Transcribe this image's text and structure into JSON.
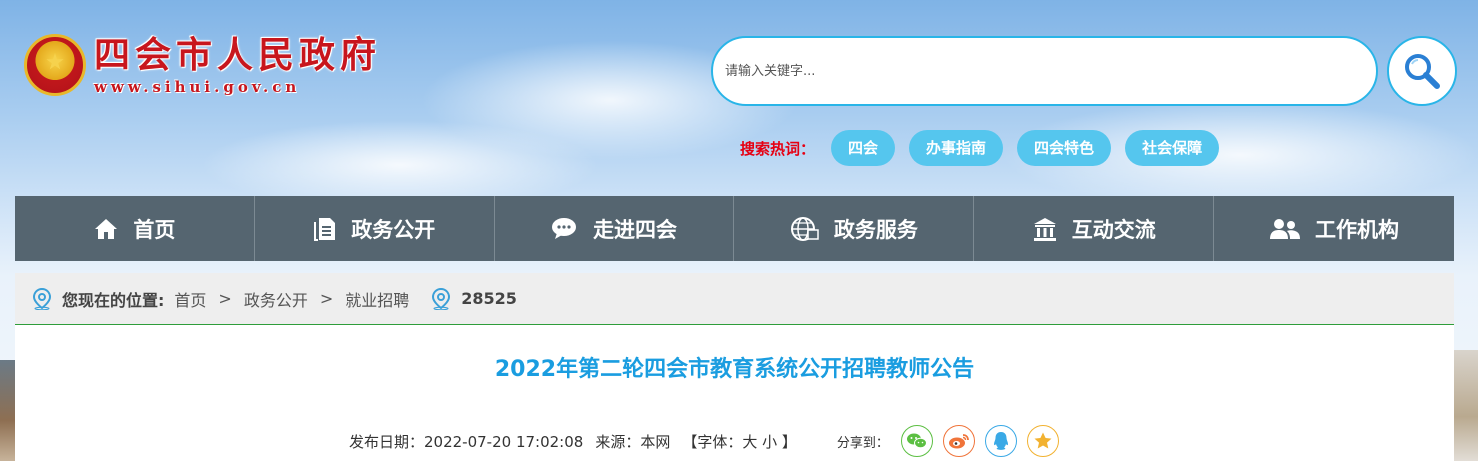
{
  "site": {
    "name_cn": "四会市人民政府",
    "name_en": "www.sihui.gov.cn"
  },
  "search": {
    "placeholder": "请输入关键字...",
    "hot_label": "搜索热词：",
    "hot_tags": [
      "四会",
      "办事指南",
      "四会特色",
      "社会保障"
    ]
  },
  "nav": {
    "items": [
      {
        "label": "首页",
        "icon": "home-icon"
      },
      {
        "label": "政务公开",
        "icon": "document-icon"
      },
      {
        "label": "走进四会",
        "icon": "chat-icon"
      },
      {
        "label": "政务服务",
        "icon": "globe-icon"
      },
      {
        "label": "互动交流",
        "icon": "building-icon"
      },
      {
        "label": "工作机构",
        "icon": "users-icon"
      }
    ]
  },
  "breadcrumb": {
    "prefix": "您现在的位置:",
    "items": [
      "首页",
      "政务公开",
      "就业招聘"
    ],
    "separator": ">",
    "count": "28525"
  },
  "article": {
    "title": "2022年第二轮四会市教育系统公开招聘教师公告",
    "date_label": "发布日期：2022-07-20 17:02:08",
    "source_label": "来源：本网",
    "font_label": "【字体：大 小 】",
    "share_label": "分享到："
  },
  "colors": {
    "nav_bg": "#556570",
    "accent_blue": "#29b5e8",
    "title_blue": "#1a9de0",
    "hot_red": "#e60012",
    "tag_bg": "#55c6ee"
  }
}
